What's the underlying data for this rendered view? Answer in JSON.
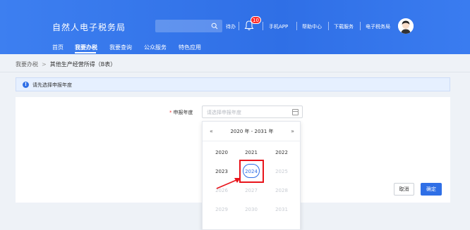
{
  "header": {
    "title": "自然人电子税务局",
    "search_placeholder": "",
    "todo": "待办",
    "notify_count": "10",
    "mobile_app": "手机APP",
    "help": "帮助中心",
    "download": "下载服务",
    "tax_bureau": "电子税务局"
  },
  "nav": {
    "items": [
      "首页",
      "我要办税",
      "我要查询",
      "公众服务",
      "特色应用"
    ],
    "active": "我要办税"
  },
  "breadcrumb": {
    "parent": "我要办税",
    "separator": ">",
    "current": "其他生产经营所得（B表）"
  },
  "notice": {
    "text": "请先选择申报年度"
  },
  "form": {
    "required_mark": "*",
    "year_label": "申报年度",
    "year_placeholder": "请选择申报年度"
  },
  "picker": {
    "prev": "«",
    "next": "»",
    "range": "2020 年 - 2031 年",
    "years": [
      {
        "label": "2020",
        "state": "normal"
      },
      {
        "label": "2021",
        "state": "normal"
      },
      {
        "label": "2022",
        "state": "normal"
      },
      {
        "label": "2023",
        "state": "normal"
      },
      {
        "label": "2024",
        "state": "current"
      },
      {
        "label": "2025",
        "state": "disabled"
      },
      {
        "label": "2026",
        "state": "disabled"
      },
      {
        "label": "2027",
        "state": "disabled"
      },
      {
        "label": "2028",
        "state": "disabled"
      },
      {
        "label": "2029",
        "state": "disabled"
      },
      {
        "label": "2030",
        "state": "disabled"
      },
      {
        "label": "2031",
        "state": "disabled"
      }
    ]
  },
  "buttons": {
    "cancel": "取消",
    "ok": "确定"
  },
  "colors": {
    "brand": "#2f6fe6",
    "highlight": "#e8141b",
    "badge": "#ff2b2b"
  }
}
